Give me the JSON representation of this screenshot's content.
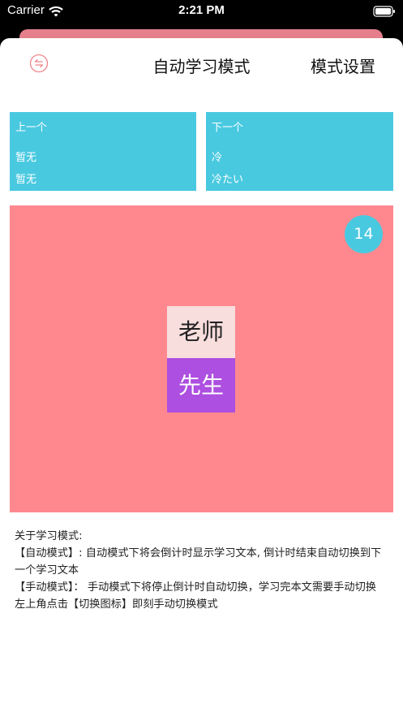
{
  "status_bar": {
    "carrier": "Carrier",
    "time": "2:21 PM"
  },
  "nav": {
    "title": "自动学习模式",
    "settings_label": "模式设置",
    "switch_icon": "switch-arrows-icon"
  },
  "prev": {
    "label": "上一个",
    "line1": "暂无",
    "line2": "暂无"
  },
  "next": {
    "label": "下一个",
    "line1": "冷",
    "line2": "冷たい"
  },
  "study": {
    "countdown": "14",
    "kanji": "老师",
    "reading": "先生"
  },
  "info": {
    "heading": "关于学习模式:",
    "auto_mode": "【自动模式】: 自动模式下将会倒计时显示学习文本, 倒计时结束自动切换到下一个学习文本",
    "manual_mode": "【手动模式】： 手动模式下将停止倒计时自动切换，学习完本文需要手动切换",
    "tip": "左上角点击【切换图标】即刻手动切换模式"
  },
  "colors": {
    "accent_blue": "#49c9e0",
    "study_bg": "#ff888f",
    "reading_bg": "#ad4fe0",
    "kanji_bg": "#f8dedd"
  }
}
